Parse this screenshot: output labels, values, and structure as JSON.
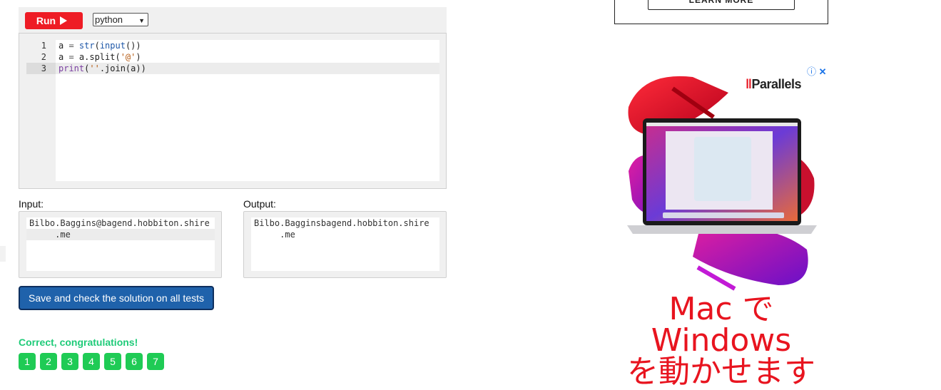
{
  "toolbar": {
    "run_label": "Run",
    "language": "python"
  },
  "editor": {
    "lines": [
      {
        "num": "1",
        "tokens": [
          [
            "",
            "a "
          ],
          [
            "op",
            "= "
          ],
          [
            "fn",
            "str"
          ],
          [
            "",
            "("
          ],
          [
            "fn",
            "input"
          ],
          [
            "",
            "())"
          ]
        ]
      },
      {
        "num": "2",
        "tokens": [
          [
            "",
            "a "
          ],
          [
            "op",
            "= "
          ],
          [
            "",
            "a.split("
          ],
          [
            "str",
            "'@'"
          ],
          [
            "",
            ")"
          ]
        ]
      },
      {
        "num": "3",
        "tokens": [
          [
            "kw",
            "print"
          ],
          [
            "",
            "("
          ],
          [
            "str",
            "''"
          ],
          [
            "",
            ".join(a))"
          ]
        ]
      }
    ],
    "active_line": 3
  },
  "input": {
    "label": "Input:",
    "lines": [
      "Bilbo.Baggins@bagend.hobbiton.shire",
      "     .me"
    ]
  },
  "output": {
    "label": "Output:",
    "lines": [
      "Bilbo.Bagginsbagend.hobbiton.shire",
      "     .me"
    ]
  },
  "save_label": "Save and check the solution on all tests",
  "result": {
    "message": "Correct, congratulations!",
    "tests": [
      "1",
      "2",
      "3",
      "4",
      "5",
      "6",
      "7"
    ]
  },
  "ad": {
    "learn_more": "LEARN MORE",
    "brand": "Parallels",
    "headline": [
      "Mac で",
      "Windows",
      "を動かせます"
    ],
    "icons": [
      "info-icon",
      "close-icon"
    ]
  },
  "colors": {
    "run": "#ee1c25",
    "save": "#1f62ab",
    "success": "#1fcb79",
    "badge": "#1fcb55",
    "ad_red": "#e8141f"
  }
}
